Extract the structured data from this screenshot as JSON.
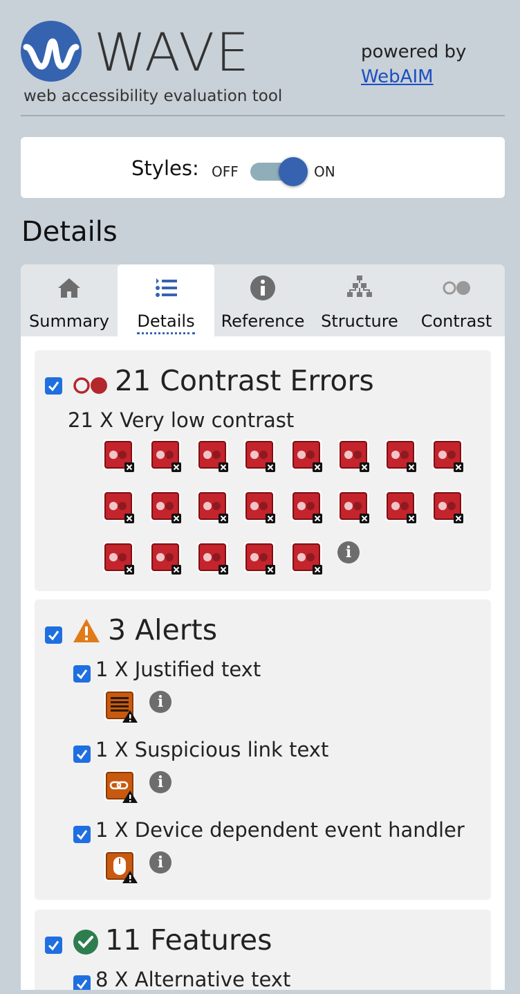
{
  "header": {
    "logo_text": "WAVE",
    "tagline": "web accessibility evaluation tool",
    "powered_by": "powered by",
    "webaim_link": "WebAIM"
  },
  "styles_toggle": {
    "label": "Styles:",
    "off": "OFF",
    "on": "ON",
    "state": "on"
  },
  "section_title": "Details",
  "tabs": [
    {
      "label": "Summary",
      "icon": "home-icon"
    },
    {
      "label": "Details",
      "icon": "list-icon",
      "active": true
    },
    {
      "label": "Reference",
      "icon": "info-icon"
    },
    {
      "label": "Structure",
      "icon": "sitemap-icon"
    },
    {
      "label": "Contrast",
      "icon": "contrast-icon"
    }
  ],
  "contrast_errors": {
    "title": "21 Contrast Errors",
    "items": [
      {
        "text": "21 X Very low contrast",
        "count": 21
      }
    ]
  },
  "alerts": {
    "title": "3 Alerts",
    "items": [
      {
        "text": "1 X Justified text",
        "icon": "justified-text-icon"
      },
      {
        "text": "1 X Suspicious link text",
        "icon": "link-icon"
      },
      {
        "text": "1 X Device dependent event handler",
        "icon": "mouse-icon"
      }
    ]
  },
  "features": {
    "title": "11 Features",
    "items": [
      {
        "text": "8 X Alternative text"
      }
    ]
  },
  "colors": {
    "brand_blue": "#3563b0",
    "error_red": "#b3272d",
    "alert_orange": "#e07b1a",
    "feature_green": "#2e7d4f",
    "checkbox_blue": "#1f6fe0"
  }
}
